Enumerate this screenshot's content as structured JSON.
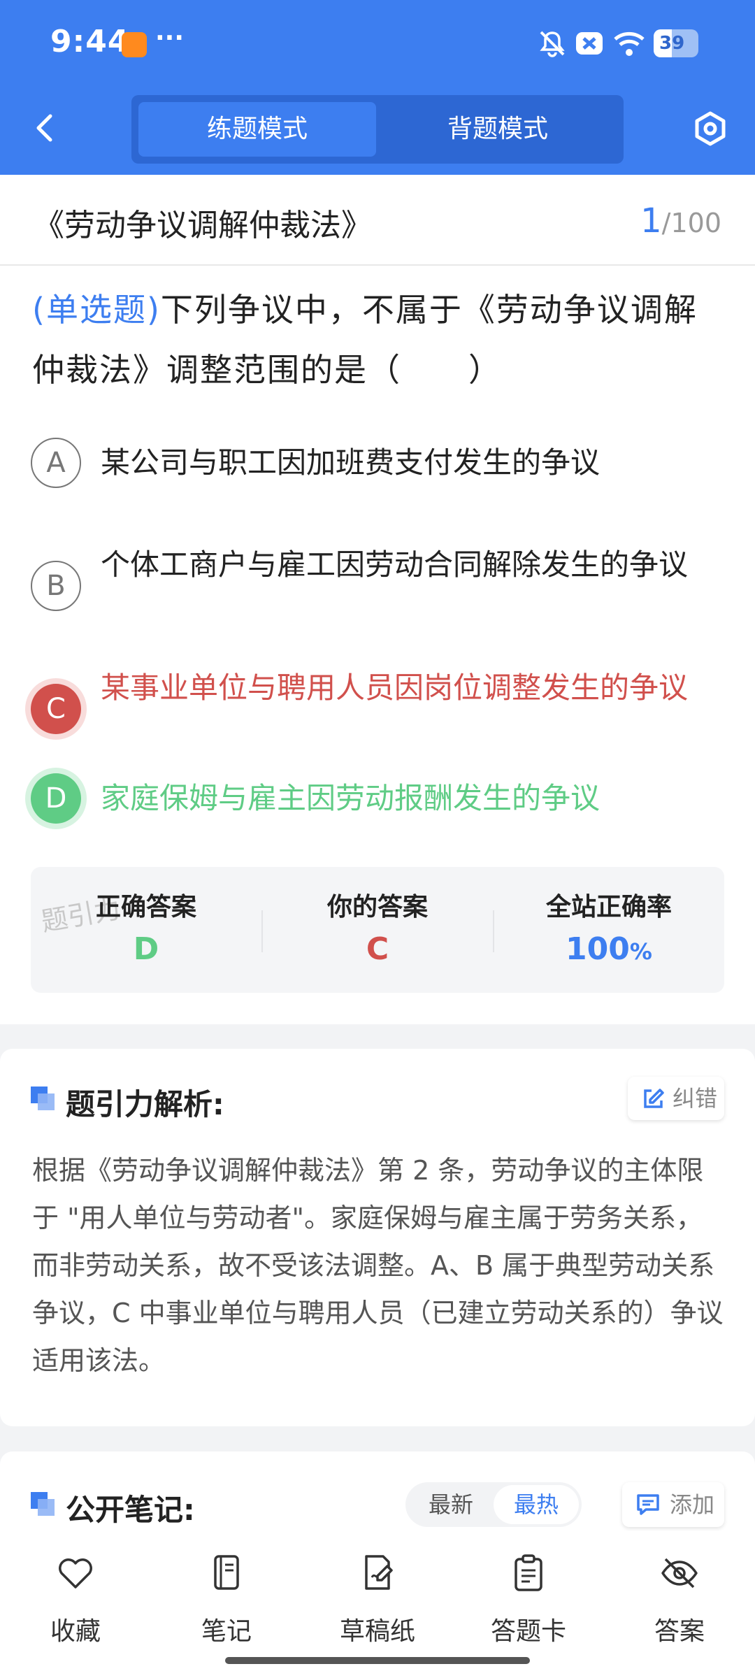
{
  "status_bar": {
    "time": "9:44",
    "dots": "···",
    "battery": "39"
  },
  "header": {
    "tabs": [
      {
        "label": "练题模式",
        "active": true
      },
      {
        "label": "背题模式",
        "active": false
      }
    ]
  },
  "question": {
    "law_title": "《劳动争议调解仲裁法》",
    "current": "1",
    "total": "/100",
    "type_label": "(单选题)",
    "text": "下列争议中，不属于《劳动争议调解仲裁法》调整范围的是（　　）",
    "options": [
      {
        "letter": "A",
        "text": "某公司与职工因加班费支付发生的争议",
        "state": "normal"
      },
      {
        "letter": "B",
        "text": "个体工商户与雇工因劳动合同解除发生的争议",
        "state": "normal"
      },
      {
        "letter": "C",
        "text": "某事业单位与聘用人员因岗位调整发生的争议",
        "state": "wrong"
      },
      {
        "letter": "D",
        "text": "家庭保姆与雇主因劳动报酬发生的争议",
        "state": "correct"
      }
    ]
  },
  "answer_summary": {
    "correct_label": "正确答案",
    "correct_value": "D",
    "yours_label": "你的答案",
    "yours_value": "C",
    "rate_label": "全站正确率",
    "rate_value": "100",
    "rate_unit": "%",
    "watermark": "题引力"
  },
  "analysis": {
    "title": "题引力解析:",
    "fix_label": "纠错",
    "text": "根据《劳动争议调解仲裁法》第 2 条，劳动争议的主体限于 \"用人单位与劳动者\"。家庭保姆与雇主属于劳务关系，而非劳动关系，故不受该法调整。A、B 属于典型劳动关系争议，C 中事业单位与聘用人员（已建立劳动关系的）争议适用该法。"
  },
  "notes": {
    "title": "公开笔记:",
    "sort_newest": "最新",
    "sort_hottest": "最热",
    "add_label": "添加"
  },
  "bottom_nav": [
    {
      "label": "收藏",
      "icon": "heart-icon"
    },
    {
      "label": "笔记",
      "icon": "notebook-icon"
    },
    {
      "label": "草稿纸",
      "icon": "draft-icon"
    },
    {
      "label": "答题卡",
      "icon": "clipboard-icon"
    },
    {
      "label": "答案",
      "icon": "eye-off-icon"
    }
  ],
  "colors": {
    "primary": "#3d7ef0",
    "wrong": "#d1504c",
    "correct": "#5fcc85"
  }
}
